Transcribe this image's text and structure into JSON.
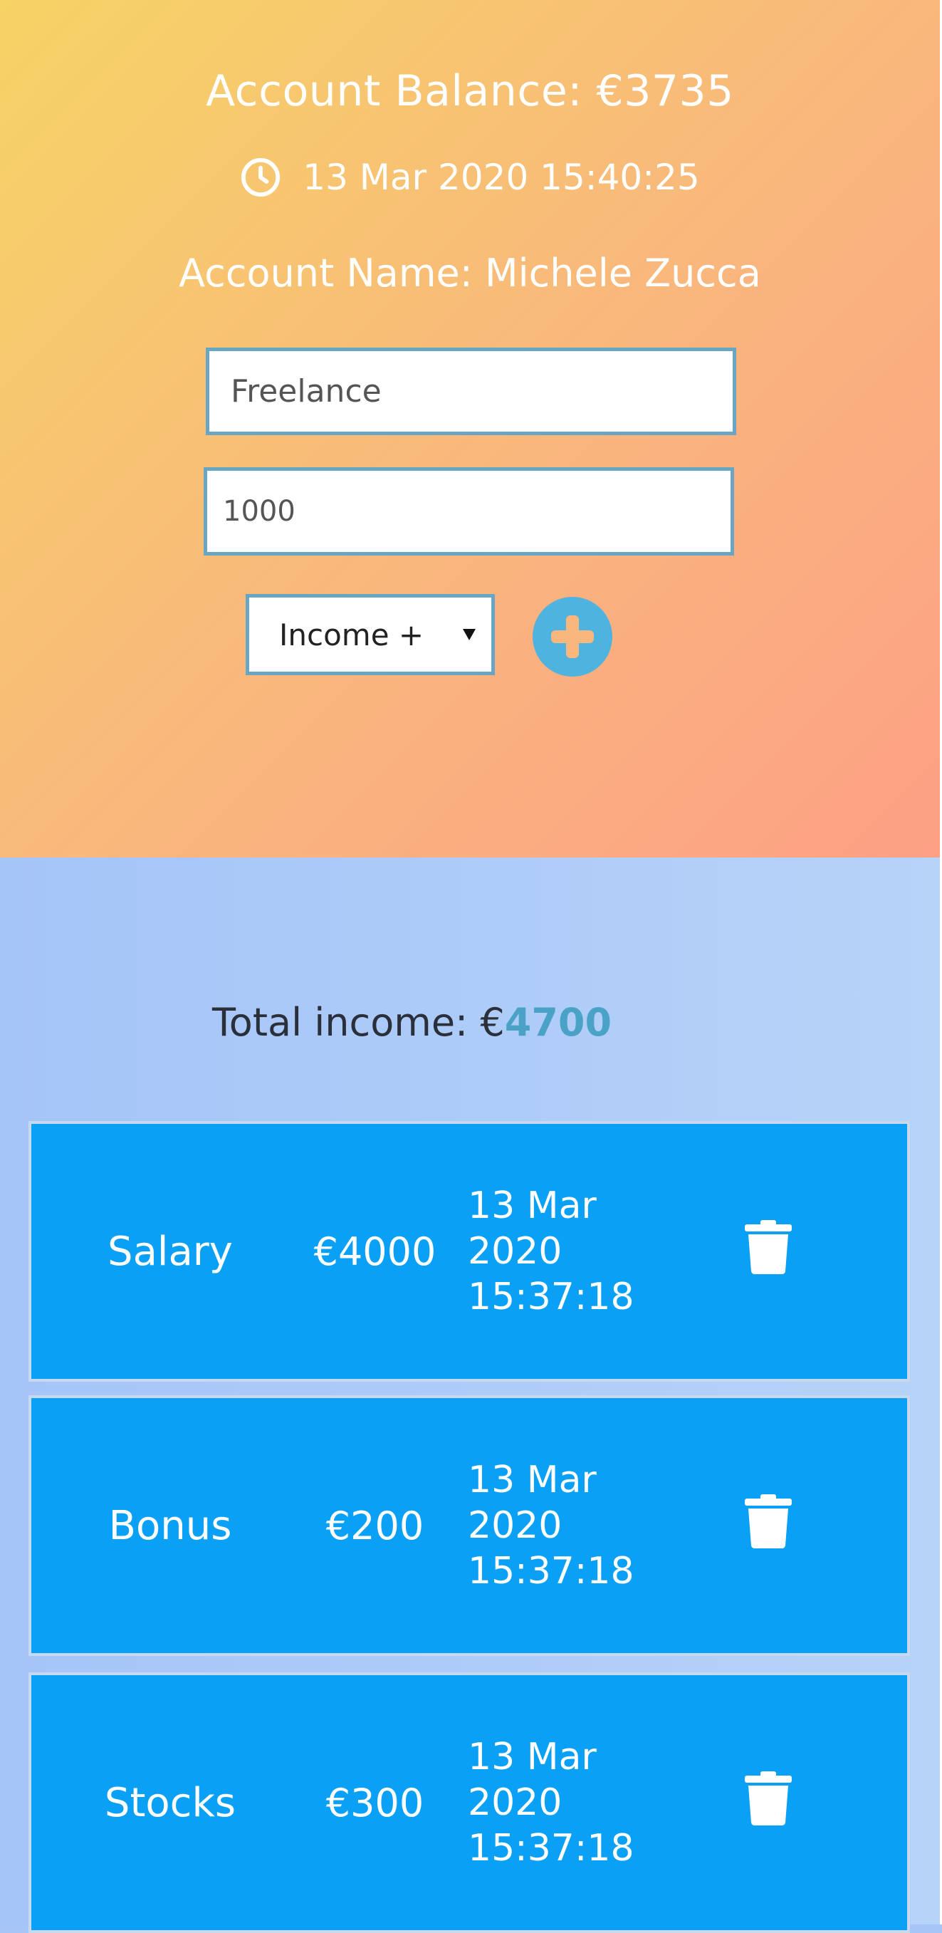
{
  "account": {
    "balance_label": "Account Balance: €3735",
    "datetime": "13 Mar 2020 15:40:25",
    "name_label": "Account Name: Michele Zucca"
  },
  "form": {
    "description_value": "Freelance",
    "amount_value": "1000",
    "type_selected": "Income +",
    "add_icon": "plus-circle-icon"
  },
  "income": {
    "total_label": "Total income: €",
    "total_value": "4700",
    "entries": [
      {
        "name": "Salary",
        "amount": "€4000",
        "date_lines": [
          "13 Mar",
          "2020",
          "15:37:18"
        ]
      },
      {
        "name": "Bonus",
        "amount": "€200",
        "date_lines": [
          "13 Mar",
          "2020",
          "15:37:18"
        ]
      },
      {
        "name": "Stocks",
        "amount": "€300",
        "date_lines": [
          "13 Mar",
          "2020",
          "15:37:18"
        ]
      }
    ],
    "delete_icon": "trash-icon"
  },
  "colors": {
    "header_gradient": [
      "#f6d365",
      "#fda085"
    ],
    "income_bg": "#a7c6f7",
    "entry_bg": "#0aa0f5",
    "accent": "#4aa3c6",
    "add_button": "#4fb3e0"
  }
}
